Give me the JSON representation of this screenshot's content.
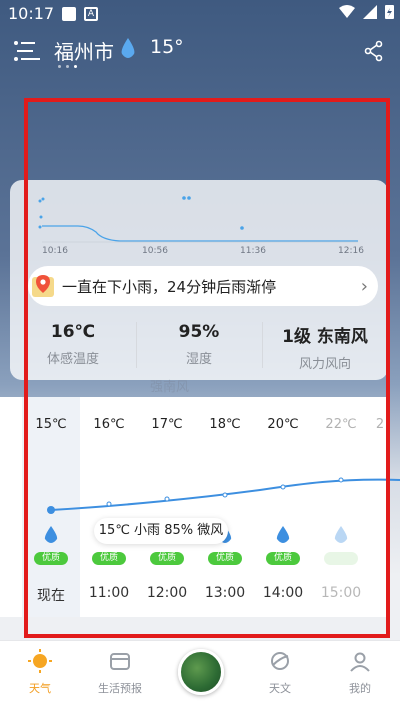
{
  "status_bar": {
    "time": "10:17"
  },
  "header": {
    "city": "福州市",
    "temperature": "15°"
  },
  "minute_rain": {
    "times": [
      "10:16",
      "10:56",
      "11:36",
      "12:16"
    ],
    "alert_text": "一直在下小雨，24分钟后雨渐停"
  },
  "stats": [
    {
      "value": "16℃",
      "label": "体感温度"
    },
    {
      "value": "95%",
      "label": "湿度"
    },
    {
      "value": "1级 东南风",
      "label": "风力风向"
    }
  ],
  "background_caption": "强南风",
  "hourly": [
    {
      "temp": "15℃",
      "aqi": "优质",
      "time": "现在"
    },
    {
      "temp": "16℃",
      "aqi": "优质",
      "time": "11:00"
    },
    {
      "temp": "17℃",
      "aqi": "优质",
      "time": "12:00"
    },
    {
      "temp": "18℃",
      "aqi": "优质",
      "time": "13:00"
    },
    {
      "temp": "20℃",
      "aqi": "优质",
      "time": "14:00"
    },
    {
      "temp": "22℃",
      "aqi": "",
      "time": "15:00"
    },
    {
      "temp": "2",
      "aqi": "",
      "time": ""
    }
  ],
  "tooltip": "15℃ 小雨 85% 微风",
  "bottom_nav": [
    {
      "label": "天气",
      "icon": "sun-icon"
    },
    {
      "label": "生活预报",
      "icon": "folder-icon"
    },
    {
      "label": "",
      "icon": "radar-map-icon"
    },
    {
      "label": "天文",
      "icon": "planet-icon"
    },
    {
      "label": "我的",
      "icon": "profile-icon"
    }
  ],
  "colors": {
    "accent": "#f29c1f",
    "aqi_good": "#4cc93d",
    "rain_line": "#4aa3e8",
    "annotation": "#e21b1b"
  }
}
